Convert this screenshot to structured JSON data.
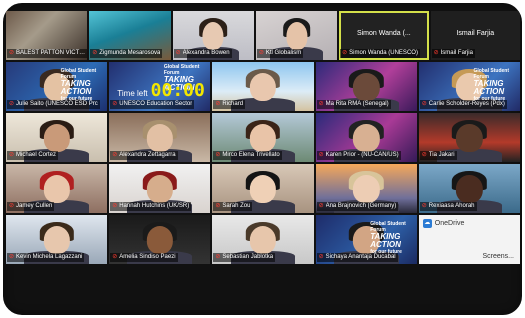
{
  "tiles": [
    {
      "name": "BALEST PATTON VICTORIO BENIN",
      "bg": "bg1",
      "muted": true,
      "person": false
    },
    {
      "name": "Zigmunda Mesarosova",
      "bg": "bg2",
      "muted": true,
      "person": false
    },
    {
      "name": "Alexandra Bowen",
      "bg": "bg3",
      "muted": true,
      "person": true,
      "skin": "#e7c9b2",
      "hair": "#2c2018"
    },
    {
      "name": "Ktl Globalism",
      "bg": "bg4",
      "muted": true,
      "person": true,
      "skin": "#e5c3a8",
      "hair": "#1a1a1a"
    },
    {
      "name": "Simon Wanda (UNESCO)",
      "bg": "bg5",
      "muted": true,
      "person": false,
      "big": "Simon Wanda (...",
      "active": true
    },
    {
      "name": "Ismail Farjia",
      "bg": "bg6",
      "muted": true,
      "person": false,
      "big": "Ismail Farjia"
    },
    {
      "name": "Julie Saito (UNESCO ESD Prc",
      "bg": "bg7",
      "muted": true,
      "person": true,
      "skin": "#e4c2a3",
      "hair": "#3a2a20",
      "banner": true
    },
    {
      "name": "UNESCO Education Sector",
      "bg": "bg10",
      "muted": true,
      "person": false,
      "clock": true
    },
    {
      "name": "Richard",
      "bg": "bg8",
      "muted": true,
      "person": true,
      "skin": "#e9c7ae",
      "hair": "#6b5a4a"
    },
    {
      "name": "Ma Rita RMA (Senegal)",
      "bg": "bg9",
      "muted": true,
      "person": true,
      "skin": "#6b4a3a",
      "hair": "#1a1a1a"
    },
    {
      "name": "Carlie Scholder-Reyes (Pdx)",
      "bg": "bg10",
      "muted": true,
      "person": true,
      "skin": "#eac9ad",
      "hair": "#c69a56",
      "banner": true
    },
    {
      "name": "Michael Cortez",
      "bg": "bg11",
      "muted": true,
      "person": true,
      "skin": "#c99a79",
      "hair": "#2a1c14"
    },
    {
      "name": "Alexandra Zettagarra",
      "bg": "bg12",
      "muted": true,
      "person": true,
      "skin": "#e2c0a4",
      "hair": "#a8906e"
    },
    {
      "name": "Mirco Elena Trivellato",
      "bg": "bg13",
      "muted": true,
      "person": true,
      "skin": "#e9c4a8",
      "hair": "#3a2418"
    },
    {
      "name": "Karen Prior - (NU-CAN/US)",
      "bg": "bg14",
      "muted": true,
      "person": true,
      "skin": "#d8b092",
      "hair": "#222222"
    },
    {
      "name": "Tia Jakari",
      "bg": "bg15",
      "muted": true,
      "person": true,
      "skin": "#5a3a2a",
      "hair": "#1a1a1a"
    },
    {
      "name": "Jamey Cullen",
      "bg": "bg16",
      "muted": true,
      "person": true,
      "skin": "#e9c6ab",
      "hair": "#b02020"
    },
    {
      "name": "Hannah Hutchins (UK/SR)",
      "bg": "bg17",
      "muted": true,
      "person": true,
      "skin": "#d6ad8c",
      "hair": "#8a1a1a"
    },
    {
      "name": "Sarah Zou",
      "bg": "bg18",
      "muted": true,
      "person": true,
      "skin": "#efd0b6",
      "hair": "#141414"
    },
    {
      "name": "Ana Brajnovich (Germany)",
      "bg": "bg19",
      "muted": true,
      "person": true,
      "skin": "#edcdb4",
      "hair": "#d8c49a"
    },
    {
      "name": "Rexiaasa Ahorah",
      "bg": "bg20",
      "muted": true,
      "person": true,
      "skin": "#4a2c20",
      "hair": "#161616"
    },
    {
      "name": "Kevin Michela Lagazzani",
      "bg": "bg21",
      "muted": true,
      "person": true,
      "skin": "#e7c7ad",
      "hair": "#3a2a1a"
    },
    {
      "name": "Amelia Sindiso Paezi",
      "bg": "bg22",
      "muted": true,
      "person": true,
      "skin": "#8a5a3a",
      "hair": "#1a1a1a"
    },
    {
      "name": "Sebastian Jablotka",
      "bg": "bg23",
      "muted": true,
      "person": true,
      "skin": "#e7c6ab",
      "hair": "#4a3a2a"
    },
    {
      "name": "Sichaya Anantaja Ducabal",
      "bg": "bg24",
      "muted": true,
      "person": true,
      "skin": "#d2a584",
      "hair": "#1a1a1a",
      "banner": true
    },
    {
      "name": "",
      "bg": "bg25",
      "muted": false,
      "person": false,
      "ondrive": true
    }
  ],
  "banner": {
    "line1": "Global Student Forum",
    "line2": "TAKING ACTION",
    "line3": "for our future"
  },
  "clock": {
    "label": "Time left",
    "value": "00:00"
  },
  "ondrive": {
    "title": "OneDrive",
    "subtitle": "Screens..."
  },
  "icons": {
    "muted_mic": "mic-off-icon"
  }
}
